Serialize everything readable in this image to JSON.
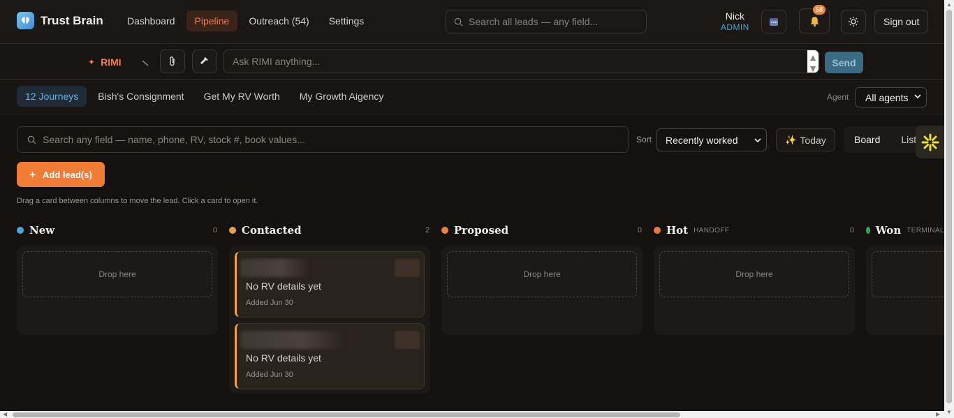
{
  "brand": {
    "name": "Trust Brain"
  },
  "nav": [
    {
      "label": "Dashboard",
      "active": false
    },
    {
      "label": "Pipeline",
      "active": true
    },
    {
      "label": "Outreach (54)",
      "active": false
    },
    {
      "label": "Settings",
      "active": false
    }
  ],
  "global_search": {
    "placeholder": "Search all leads — any field..."
  },
  "user": {
    "name": "Nick",
    "role": "ADMIN"
  },
  "notifications": {
    "count": "58"
  },
  "signout_label": "Sign out",
  "rimi": {
    "label": "RIMI",
    "placeholder": "Ask RIMI anything...",
    "send_label": "Send"
  },
  "journeys": [
    {
      "label": "12 Journeys",
      "active": true
    },
    {
      "label": "Bish's Consignment",
      "active": false
    },
    {
      "label": "Get My RV Worth",
      "active": false
    },
    {
      "label": "My Growth Aigency",
      "active": false
    }
  ],
  "agent": {
    "label": "Agent",
    "selected": "All agents"
  },
  "lead_search": {
    "placeholder": "Search any field — name, phone, RV, stock #, book values..."
  },
  "sort": {
    "label": "Sort",
    "selected": "Recently worked"
  },
  "today_label": "Today",
  "views": {
    "board": "Board",
    "list": "List"
  },
  "add_lead_label": "Add lead(s)",
  "hint": "Drag a card between columns to move the lead. Click a card to open it.",
  "drop_label": "Drop here",
  "columns": [
    {
      "title": "New",
      "tag": "",
      "count": "0",
      "color": "#4fa3d9"
    },
    {
      "title": "Contacted",
      "tag": "",
      "count": "2",
      "color": "#e8a04a"
    },
    {
      "title": "Proposed",
      "tag": "",
      "count": "0",
      "color": "#e8843a"
    },
    {
      "title": "Hot",
      "tag": "HANDOFF",
      "count": "0",
      "color": "#e87a3a"
    },
    {
      "title": "Won",
      "tag": "TERMINAL",
      "count": "",
      "color": "#2fa85a"
    }
  ],
  "cards": [
    {
      "title": "No RV details yet",
      "date": "Added Jun 30"
    },
    {
      "title": "No RV details yet",
      "date": "Added Jun 30"
    }
  ]
}
